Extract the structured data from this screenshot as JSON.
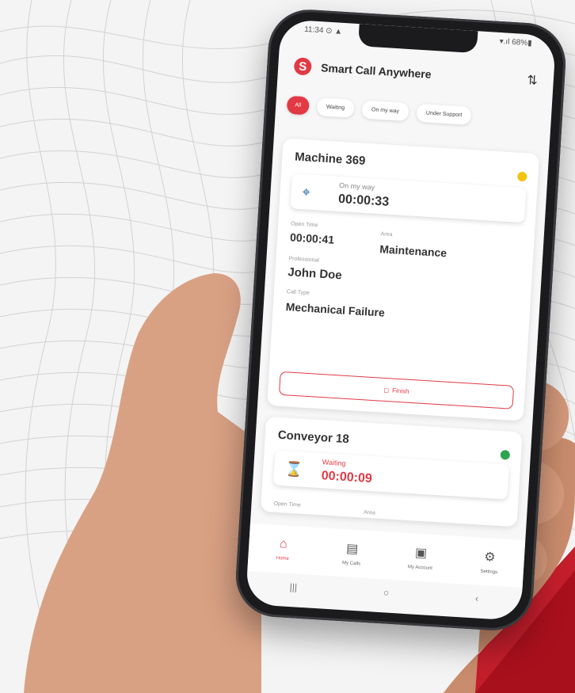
{
  "statusbar": {
    "time": "11:34 ⊙ ▲",
    "right": "▾.ıl 68%▮"
  },
  "app": {
    "title": "Smart Call Anywhere",
    "logo_letter": "S",
    "accent": "#e23a45"
  },
  "filters": [
    {
      "label": "All",
      "active": true
    },
    {
      "label": "Waiting",
      "active": false
    },
    {
      "label": "On my way",
      "active": false
    },
    {
      "label": "Under Support",
      "active": false
    }
  ],
  "cards": [
    {
      "title": "Machine 369",
      "status_color": "#f1c40f",
      "status_label": "On my way",
      "status_time": "00:00:33",
      "open_time_label": "Open Time",
      "open_time": "00:00:41",
      "area_label": "Area",
      "area": "Maintenance",
      "professional_label": "Professional",
      "professional": "John Doe",
      "call_type_label": "Call Type",
      "call_type": "Mechanical Failure",
      "action_label": "Finish"
    },
    {
      "title": "Conveyor 18",
      "status_color": "#2ea44f",
      "status_label": "Waiting",
      "status_time": "00:00:09",
      "open_time_label": "Open Time",
      "area_label": "Area"
    }
  ],
  "bottom_nav": [
    {
      "label": "Home",
      "icon": "home-icon",
      "active": true
    },
    {
      "label": "My Calls",
      "icon": "clipboard-icon",
      "active": false
    },
    {
      "label": "My Account",
      "icon": "user-card-icon",
      "active": false
    },
    {
      "label": "Settings",
      "icon": "gear-icon",
      "active": false
    }
  ]
}
